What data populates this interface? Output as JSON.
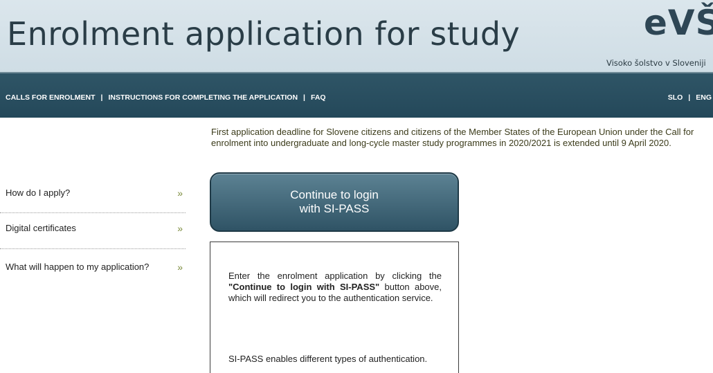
{
  "header": {
    "title": "Enrolment application for study",
    "logo_text": "eVŠ",
    "logo_subtitle": "Visoko šolstvo v Sloveniji"
  },
  "nav": {
    "calls": "CALLS FOR ENROLMENT",
    "instructions": "INSTRUCTIONS FOR COMPLETING THE APPLICATION",
    "faq": "FAQ",
    "separator": "|",
    "lang_slo": "SLO",
    "lang_eng": "ENG"
  },
  "notice": "First application deadline for Slovene citizens and citizens of the Member States of the European Union under the Call for enrolment into undergraduate and long-cycle master study programmes in 2020/2021 is extended until 9 April 2020.",
  "sidebar": {
    "chevron": "»",
    "items": [
      {
        "label": "How do I apply?"
      },
      {
        "label": "Digital certificates"
      },
      {
        "label": "What will happen to my application?"
      }
    ]
  },
  "login_button": {
    "line1": "Continue to login",
    "line2": "with SI-PASS"
  },
  "info": {
    "p1_before": "Enter the enrolment application by clicking the ",
    "p1_bold": "\"Continue to login with SI-PASS\"",
    "p1_after": " button above, which will redirect you to the authentication service.",
    "p2": "SI-PASS enables different types of authentication."
  },
  "colors": {
    "banner_bg": "#d4e1e8",
    "navbar_bg": "#2a4f61",
    "button_bg": "#3f6476",
    "chevron": "#7a8a3a",
    "notice_text": "#3b3b1a"
  }
}
